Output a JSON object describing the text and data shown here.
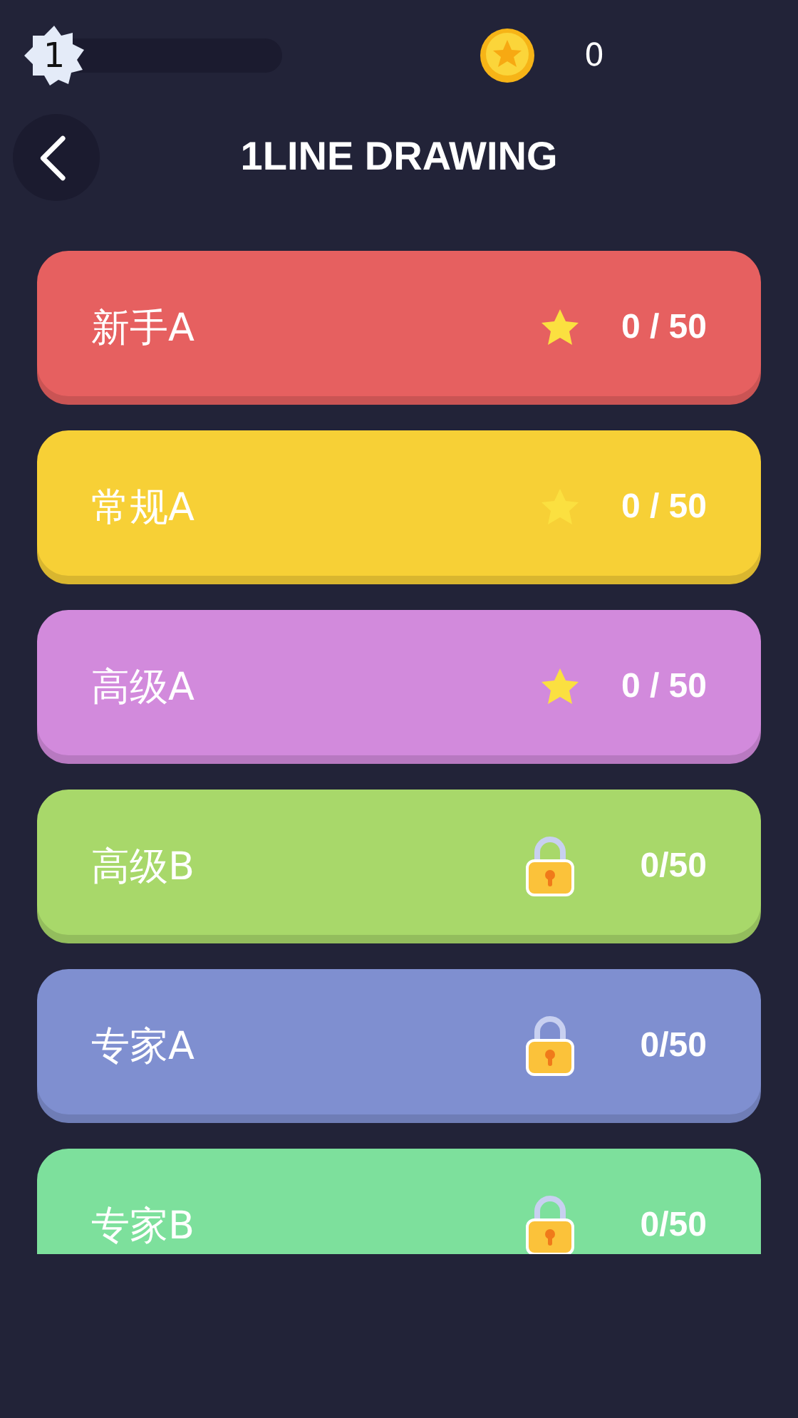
{
  "player": {
    "level_badge": "1"
  },
  "coins": {
    "count": "0"
  },
  "header": {
    "title": "1LINE DRAWING"
  },
  "levels": [
    {
      "name": "新手A",
      "locked": false,
      "progress": "0 / 50",
      "color": "#e66060"
    },
    {
      "name": "常规A",
      "locked": false,
      "progress": "0 / 50",
      "color": "#f7d036"
    },
    {
      "name": "高级A",
      "locked": false,
      "progress": "0 / 50",
      "color": "#d28adc"
    },
    {
      "name": "高级B",
      "locked": true,
      "progress": "0/50",
      "color": "#a8d86a"
    },
    {
      "name": "专家A",
      "locked": true,
      "progress": "0/50",
      "color": "#7f8fd0"
    },
    {
      "name": "专家B",
      "locked": true,
      "progress": "0/50",
      "color": "#7de09c"
    }
  ]
}
